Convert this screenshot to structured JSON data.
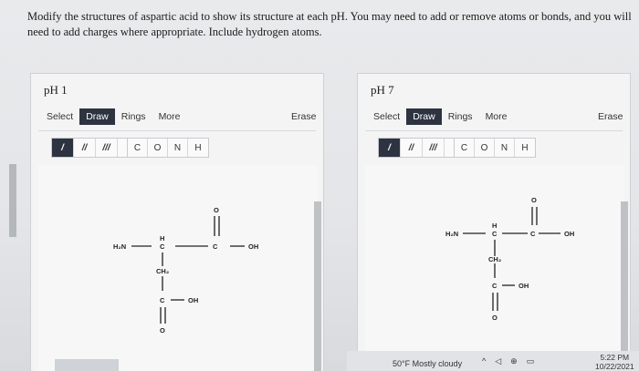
{
  "question": {
    "text": "Modify the structures of aspartic acid to show its structure at each pH. You may need to add or remove atoms or bonds, and you will need to add charges where appropriate. Include hydrogen atoms."
  },
  "panels": [
    {
      "title": "pH 1",
      "toolbar": {
        "select": "Select",
        "draw": "Draw",
        "rings": "Rings",
        "more": "More",
        "erase": "Erase"
      },
      "bonds": [
        "/",
        "//",
        "///"
      ],
      "atoms": [
        "C",
        "O",
        "N",
        "H"
      ],
      "molecule": {
        "h2n": "H₂N",
        "alpha_c": "C",
        "alpha_h": "H",
        "carboxyl_c": "C",
        "carboxyl_o": "O",
        "carboxyl_oh": "OH",
        "ch2": "CH₂",
        "side_c": "C",
        "side_oh": "OH",
        "side_o": "O"
      }
    },
    {
      "title": "pH 7",
      "toolbar": {
        "select": "Select",
        "draw": "Draw",
        "rings": "Rings",
        "more": "More",
        "erase": "Erase"
      },
      "bonds": [
        "/",
        "//",
        "///"
      ],
      "atoms": [
        "C",
        "O",
        "N",
        "H"
      ],
      "molecule": {
        "h2n": "H₂N",
        "alpha_c": "C",
        "alpha_h": "H",
        "carboxyl_c": "C",
        "carboxyl_o": "O",
        "carboxyl_oh": "OH",
        "ch2": "CH₂",
        "side_c": "C",
        "side_oh": "OH",
        "side_o": "O"
      }
    }
  ],
  "taskbar": {
    "weather": "50°F Mostly cloudy",
    "time": "5:22 PM",
    "date": "10/22/2021",
    "tray_icons": [
      "chevron-up-icon",
      "speaker-icon",
      "globe-icon",
      "battery-icon"
    ]
  }
}
